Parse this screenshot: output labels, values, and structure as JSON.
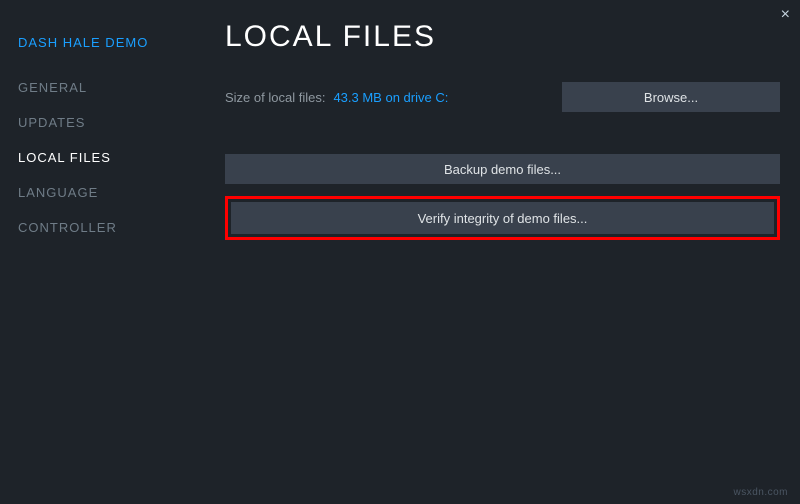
{
  "close_label": "×",
  "sidebar": {
    "game_title": "DASH HALE DEMO",
    "items": [
      {
        "label": "GENERAL",
        "active": false
      },
      {
        "label": "UPDATES",
        "active": false
      },
      {
        "label": "LOCAL FILES",
        "active": true
      },
      {
        "label": "LANGUAGE",
        "active": false
      },
      {
        "label": "CONTROLLER",
        "active": false
      }
    ]
  },
  "main": {
    "title": "LOCAL FILES",
    "size_label": "Size of local files:",
    "size_value": "43.3 MB on drive C:",
    "browse_label": "Browse...",
    "backup_label": "Backup demo files...",
    "verify_label": "Verify integrity of demo files..."
  },
  "watermark": "wsxdn.com"
}
